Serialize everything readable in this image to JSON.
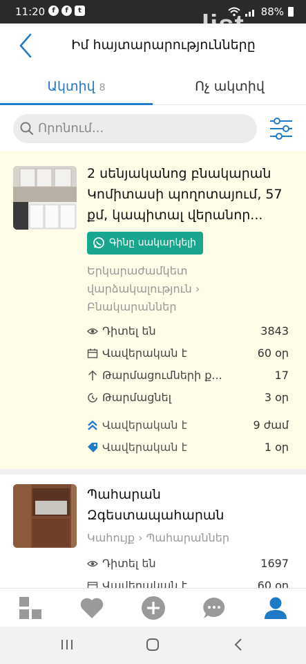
{
  "status_bar": {
    "time": "11:20",
    "battery": "88%",
    "notification_icons": [
      "f",
      "f",
      "t"
    ]
  },
  "watermark": "list",
  "header": {
    "title": "Իմ հայտարարությունները",
    "back_icon": "chevron-left-icon"
  },
  "tabs": [
    {
      "label": "Ակտիվ",
      "count": "8",
      "active": true
    },
    {
      "label": "Ոչ ակտիվ",
      "active": false
    }
  ],
  "search": {
    "placeholder": "Որոնում..."
  },
  "listings": [
    {
      "title": "2 սենյականոց բնակարան Կոմիտասի պողոտայում, 57 քմ, կապիտալ վերանոր...",
      "badge": "Գինը սակարկելի",
      "category": "Երկարաժամկետ վարձակալություն › Բնակարաններ",
      "stats": [
        {
          "icon": "eye-icon",
          "label": "Դիտել են",
          "value": "3843"
        },
        {
          "icon": "calendar-icon",
          "label": "Վավերական է",
          "value": "60 օր"
        },
        {
          "icon": "arrow-up-icon",
          "label": "Թարմացումների ք...",
          "value": "17"
        },
        {
          "icon": "clock-refresh-icon",
          "label": "Թարմացնել",
          "value": "3 օր"
        },
        {
          "icon": "double-chevron-up-icon",
          "label": "Վավերական է",
          "value": "9 ժամ"
        },
        {
          "icon": "tag-icon",
          "label": "Վավերական է",
          "value": "1 օր"
        }
      ]
    },
    {
      "title": "Պահարան Զգեստապահարան",
      "category": "Կահույք › Պահարաններ",
      "stats": [
        {
          "icon": "eye-icon",
          "label": "Դիտել են",
          "value": "1697"
        },
        {
          "icon": "calendar-icon",
          "label": "Վավերական է",
          "value": "60 օր"
        }
      ]
    }
  ],
  "bottom_nav": [
    {
      "icon": "categories-icon",
      "active": false
    },
    {
      "icon": "heart-icon",
      "active": false
    },
    {
      "icon": "plus-circle-icon",
      "active": false
    },
    {
      "icon": "chat-bubble-icon",
      "active": false
    },
    {
      "icon": "user-icon",
      "active": true
    }
  ],
  "colors": {
    "accent": "#1f7ac8",
    "badge": "#19a68e",
    "highlight_bg": "#fffce8",
    "icon_gray": "#9a9a9a"
  }
}
